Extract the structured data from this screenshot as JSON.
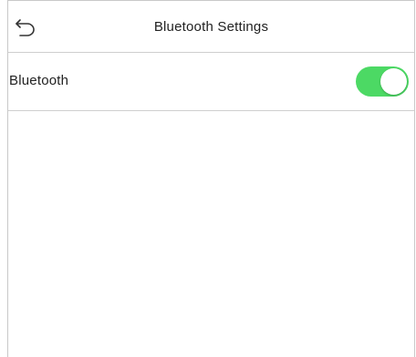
{
  "header": {
    "title": "Bluetooth Settings",
    "back_icon": "back-arrow-icon"
  },
  "settings": {
    "bluetooth": {
      "label": "Bluetooth",
      "enabled": true
    }
  },
  "colors": {
    "toggle_on": "#4cd964",
    "toggle_off": "#d8d8d8",
    "divider": "#cfcfcf",
    "text": "#222222"
  }
}
